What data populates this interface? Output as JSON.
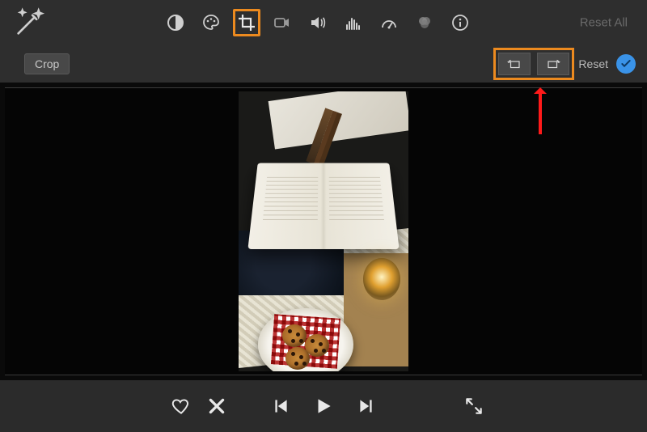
{
  "toolbar": {
    "reset_all_label": "Reset All",
    "icons": {
      "magic": "magic-wand-icon",
      "contrast": "contrast-icon",
      "palette": "palette-icon",
      "crop": "crop-icon",
      "camera": "video-camera-icon",
      "volume": "volume-icon",
      "equalizer": "equalizer-icon",
      "speed": "speedometer-icon",
      "color_filter": "color-circles-icon",
      "info": "info-icon"
    },
    "selected_tool": "crop"
  },
  "subbar": {
    "crop_button_label": "Crop",
    "rotate_ccw_title": "rotate-counterclockwise-icon",
    "rotate_cw_title": "rotate-clockwise-icon",
    "reset_label": "Reset",
    "apply_title": "apply-checkmark-icon"
  },
  "footer": {
    "favorite_title": "heart-icon",
    "reject_title": "x-icon",
    "prev_title": "previous-frame-icon",
    "play_title": "play-icon",
    "next_title": "next-frame-icon",
    "fullscreen_title": "fullscreen-icon"
  },
  "annotation": {
    "highlight_crop_tool": true,
    "highlight_rotate_buttons": true,
    "red_arrow_points_to": "rotate-buttons"
  }
}
